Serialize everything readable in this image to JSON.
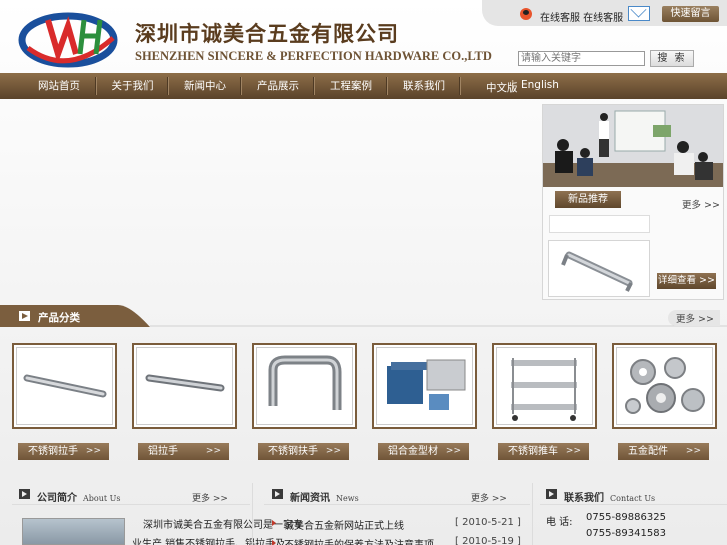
{
  "header": {
    "company_cn": "深圳市诚美合五金有限公司",
    "company_en": "SHENZHEN SINCERE & PERFECTION HARDWARE CO.,LTD",
    "online_service": "在线客服  在线客服",
    "quick_message": "快速留言",
    "search_placeholder": "请输入关键字",
    "search_button": "搜 索"
  },
  "nav": {
    "items": [
      "网站首页",
      "关于我们",
      "新闻中心",
      "产品展示",
      "工程案例",
      "联系我们"
    ],
    "lang_cn": "中文版",
    "lang_sep": "|",
    "lang_en": "English"
  },
  "promo": {
    "tag": "新品推荐",
    "more": "更多 >>",
    "detail_button": "详细查看 >>"
  },
  "categories": {
    "title": "产品分类",
    "more": "更多 >>",
    "items": [
      {
        "label": "不锈钢拉手"
      },
      {
        "label": "铝拉手"
      },
      {
        "label": "不锈钢扶手"
      },
      {
        "label": "铝合金型材"
      },
      {
        "label": "不锈钢推车"
      },
      {
        "label": "五金配件"
      }
    ],
    "arrow": ">>"
  },
  "about": {
    "title": "公司简介",
    "title_en": "About Us",
    "more": "更多 >>",
    "line1": "深圳市诚美合五金有限公司是一家专",
    "line2": "业生产,销售不锈钢拉手、铝拉手及"
  },
  "news": {
    "title": "新闻资讯",
    "title_en": "News",
    "more": "更多 >>",
    "items": [
      {
        "text": "诚美合五金新网站正式上线",
        "date": "[ 2010-5-21 ]"
      },
      {
        "text": "不锈钢拉手的保养方法及注意事项...",
        "date": "[ 2010-5-19 ]"
      }
    ]
  },
  "contact": {
    "title": "联系我们",
    "title_en": "Contact Us",
    "label": "电 话:",
    "phone1": "0755-89886325",
    "phone2": "0755-89341583"
  },
  "colors": {
    "brand_brown": "#705538",
    "logo_blue": "#1a4f9c",
    "logo_red": "#d92b2b",
    "logo_green": "#2c8f3d"
  }
}
